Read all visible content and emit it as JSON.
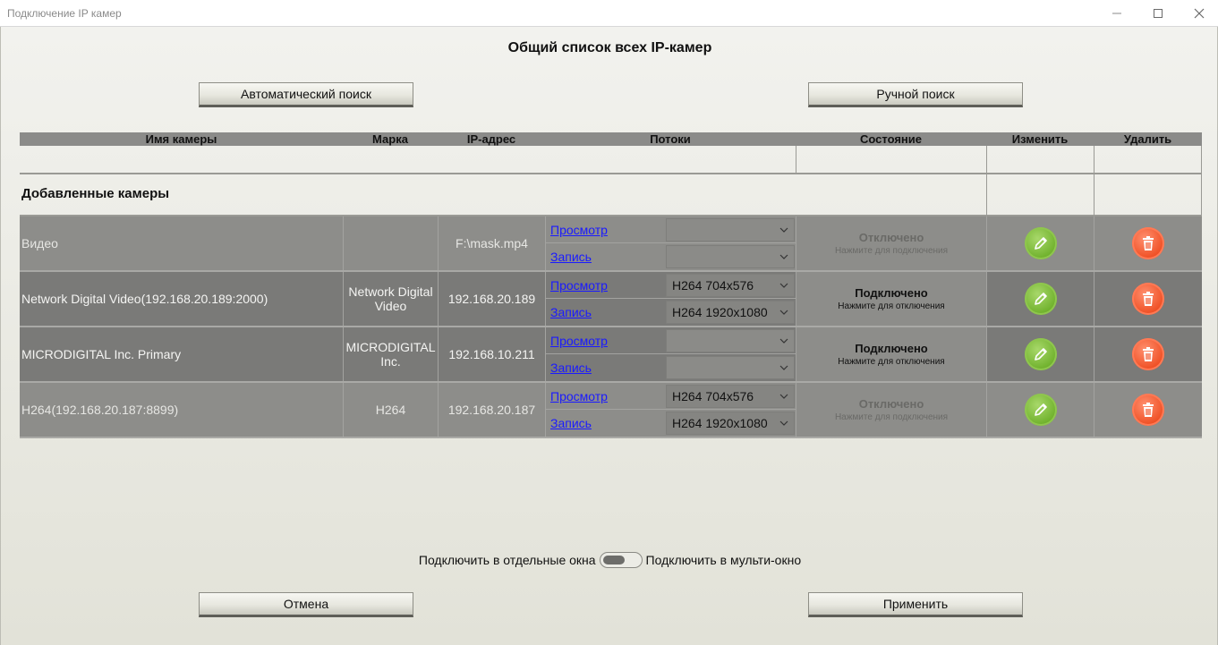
{
  "window": {
    "title": "Подключение IP камер"
  },
  "heading": "Общий список всех IP-камер",
  "buttons": {
    "auto_search": "Автоматический поиск",
    "manual_search": "Ручной поиск",
    "cancel": "Отмена",
    "apply": "Применить"
  },
  "table": {
    "columns": [
      "Имя камеры",
      "Марка",
      "IP-адрес",
      "Потоки",
      "Состояние",
      "Изменить",
      "Удалить"
    ],
    "section_label": "Добавленные камеры",
    "rows": [
      {
        "name": "Видео",
        "brand": "",
        "ip": "F:\\mask.mp4",
        "view_link": "Просмотр",
        "record_link": "Запись",
        "view_stream": "",
        "record_stream": "",
        "state": "Отключено",
        "state_hint": "Нажмите для подключения"
      },
      {
        "name": "Network Digital Video(192.168.20.189:2000)",
        "brand": "Network Digital Video",
        "ip": "192.168.20.189",
        "view_link": "Просмотр",
        "record_link": "Запись",
        "view_stream": "H264 704x576",
        "record_stream": "H264 1920x1080",
        "state": "Подключено",
        "state_hint": "Нажмите для отключения"
      },
      {
        "name": "MICRODIGITAL Inc. Primary",
        "brand": "MICRODIGITAL Inc.",
        "ip": "192.168.10.211",
        "view_link": "Просмотр",
        "record_link": "Запись",
        "view_stream": "",
        "record_stream": "",
        "state": "Подключено",
        "state_hint": "Нажмите для отключения"
      },
      {
        "name": "H264(192.168.20.187:8899)",
        "brand": "H264",
        "ip": "192.168.20.187",
        "view_link": "Просмотр",
        "record_link": "Запись",
        "view_stream": "H264 704x576",
        "record_stream": "H264 1920x1080",
        "state": "Отключено",
        "state_hint": "Нажмите для подключения"
      }
    ]
  },
  "connect_mode": {
    "left_label": "Подключить в отдельные окна",
    "right_label": "Подключить в мульти-окно"
  },
  "colors": {
    "accent_green": "#6fb12c",
    "accent_red": "#ef4f24",
    "link": "#1a1aff"
  },
  "icons": {
    "edit": "pencil-icon",
    "delete": "trash-icon",
    "minimize": "minimize-icon",
    "maximize": "maximize-icon",
    "close": "close-icon",
    "dropdown": "chevron-down-icon"
  }
}
